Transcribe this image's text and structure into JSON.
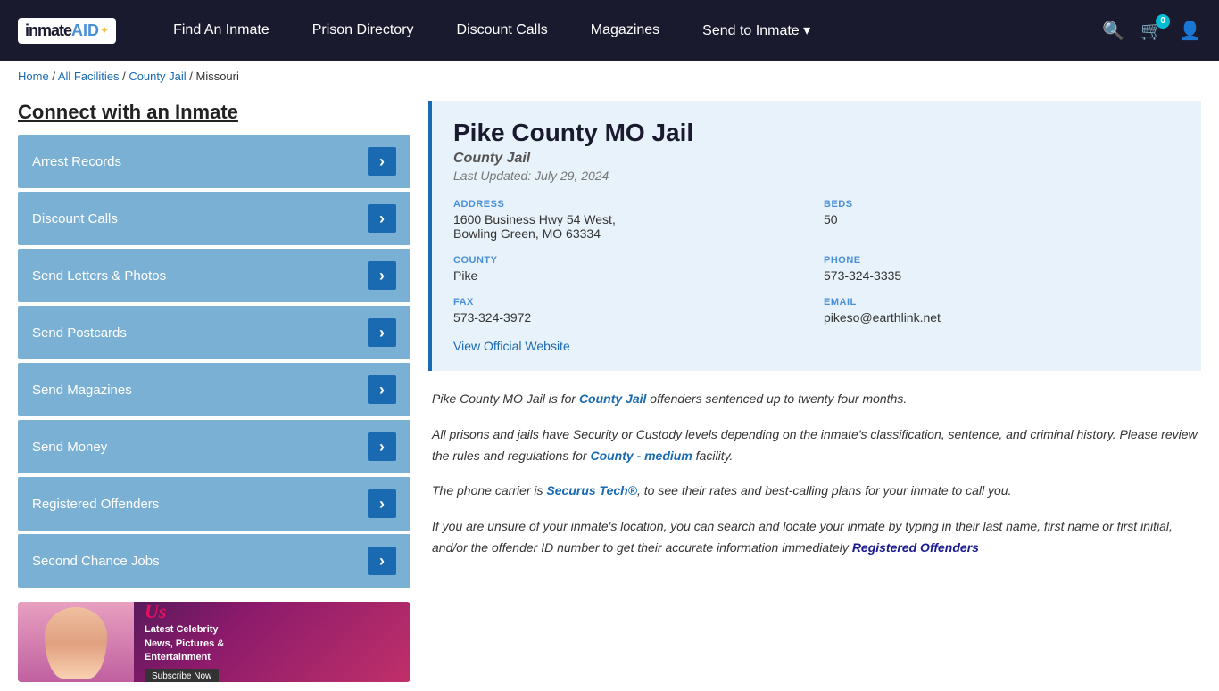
{
  "nav": {
    "logo_text": "inmate",
    "logo_aid": "AID",
    "links": [
      {
        "label": "Find An Inmate",
        "name": "find-an-inmate"
      },
      {
        "label": "Prison Directory",
        "name": "prison-directory"
      },
      {
        "label": "Discount Calls",
        "name": "discount-calls"
      },
      {
        "label": "Magazines",
        "name": "magazines"
      },
      {
        "label": "Send to Inmate ▾",
        "name": "send-to-inmate"
      }
    ],
    "cart_count": "0"
  },
  "breadcrumb": {
    "home": "Home",
    "all_facilities": "All Facilities",
    "county_jail": "County Jail",
    "state": "Missouri"
  },
  "sidebar": {
    "title": "Connect with an Inmate",
    "items": [
      {
        "label": "Arrest Records"
      },
      {
        "label": "Discount Calls"
      },
      {
        "label": "Send Letters & Photos"
      },
      {
        "label": "Send Postcards"
      },
      {
        "label": "Send Magazines"
      },
      {
        "label": "Send Money"
      },
      {
        "label": "Registered Offenders"
      },
      {
        "label": "Second Chance Jobs"
      }
    ]
  },
  "ad": {
    "brand": "Us",
    "tagline": "Latest Celebrity\nNews, Pictures &\nEntertainment",
    "subscribe": "Subscribe Now"
  },
  "facility": {
    "name": "Pike County MO Jail",
    "type": "County Jail",
    "updated": "Last Updated: July 29, 2024",
    "address_label": "ADDRESS",
    "address_value": "1600 Business Hwy 54 West,\nBowling Green, MO 63334",
    "beds_label": "BEDS",
    "beds_value": "50",
    "county_label": "COUNTY",
    "county_value": "Pike",
    "phone_label": "PHONE",
    "phone_value": "573-324-3335",
    "fax_label": "FAX",
    "fax_value": "573-324-3972",
    "email_label": "EMAIL",
    "email_value": "pikeso@earthlink.net",
    "website_label": "View Official Website",
    "website_url": "#"
  },
  "descriptions": [
    {
      "text_before": "Pike County MO Jail is for ",
      "highlight": "County Jail",
      "text_after": " offenders sentenced up to twenty four months."
    },
    {
      "text_before": "All prisons and jails have Security or Custody levels depending on the inmate’s classification, sentence, and criminal history. Please review the rules and regulations for ",
      "highlight": "County - medium",
      "text_after": " facility."
    },
    {
      "text_before": "The phone carrier is ",
      "highlight": "Securus Tech®",
      "text_after": ", to see their rates and best-calling plans for your inmate to call you."
    },
    {
      "text_before": "If you are unsure of your inmate’s location, you can search and locate your inmate by typing in their last name, first name or first initial, and/or the offender ID number to get their accurate information immediately ",
      "highlight": "Registered Offenders",
      "text_after": ""
    }
  ]
}
